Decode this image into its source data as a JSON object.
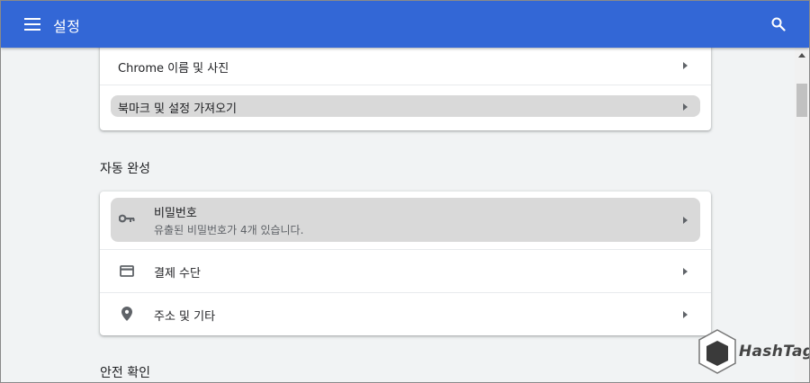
{
  "header": {
    "title": "설정",
    "menu_icon": "hamburger-menu-icon",
    "search_icon": "search-icon"
  },
  "colors": {
    "topbar": "#3367d6",
    "background": "#f1f3f4",
    "highlight": "#d9d9d9"
  },
  "card_top": {
    "items": [
      {
        "label": "Chrome 이름 및 사진"
      },
      {
        "label": "북마크 및 설정 가져오기"
      }
    ]
  },
  "autofill": {
    "section_title": "자동 완성",
    "items": [
      {
        "label": "비밀번호",
        "sub": "유출된 비밀번호가 4개 있습니다.",
        "icon": "key-icon"
      },
      {
        "label": "결제 수단",
        "icon": "credit-card-icon"
      },
      {
        "label": "주소 및 기타",
        "icon": "location-pin-icon"
      }
    ]
  },
  "safety": {
    "section_title": "안전 확인"
  },
  "watermark": {
    "text": "HashTag"
  }
}
